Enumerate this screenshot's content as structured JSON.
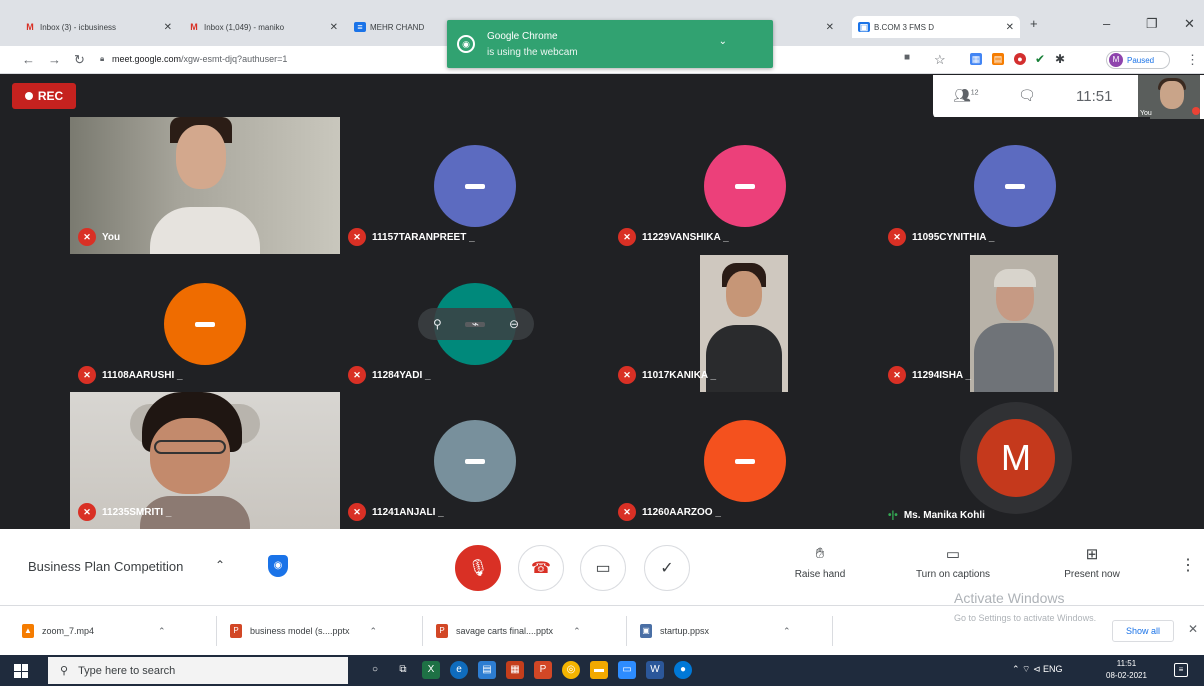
{
  "browser": {
    "tabs": [
      {
        "label": "Inbox (3) - icbusiness",
        "icon": "gmail-icon"
      },
      {
        "label": "Inbox (1,049) - maniko",
        "icon": "gmail-icon"
      },
      {
        "label": "MEHR CHAND",
        "icon": "docs-icon"
      },
      {
        "label": "B.COM 3 FMS D",
        "icon": "meet-icon"
      }
    ],
    "new_tab": "+",
    "url_domain": "meet.google.com",
    "url_path": "/xgw-esmt-djq?authuser=1",
    "profile_status": "Paused",
    "profile_initial": "M",
    "window_controls": [
      "–",
      "❐",
      "✕"
    ]
  },
  "webcam_notice": {
    "title": "Google Chrome",
    "message": "is using the webcam"
  },
  "meet": {
    "rec_label": "REC",
    "participants_count": "12",
    "time": "11:51",
    "self_label": "You",
    "tiles": [
      {
        "name": "You",
        "type": "video",
        "muted": true
      },
      {
        "name": "11157TARANPREET _",
        "type": "avatar",
        "color": "#5c6bc0",
        "muted": true
      },
      {
        "name": "11229VANSHIKA _",
        "type": "avatar",
        "color": "#ec407a",
        "muted": true
      },
      {
        "name": "11095CYNITHIA _",
        "type": "avatar",
        "color": "#5c6bc0",
        "muted": true
      },
      {
        "name": "11108AARUSHI _",
        "type": "avatar",
        "color": "#ef6c00",
        "muted": true
      },
      {
        "name": "11284YADI _",
        "type": "avatar",
        "color": "#00897b",
        "muted": true
      },
      {
        "name": "11017KANIKA _",
        "type": "video",
        "muted": true
      },
      {
        "name": "11294ISHA _",
        "type": "video",
        "muted": true
      },
      {
        "name": "11235SMRITI _",
        "type": "video",
        "muted": true
      },
      {
        "name": "11241ANJALI _",
        "type": "avatar",
        "color": "#78909c",
        "muted": true
      },
      {
        "name": "11260AARZOO _",
        "type": "avatar",
        "color": "#f4511e",
        "muted": true
      },
      {
        "name": "Ms. Manika Kohli",
        "type": "speaking",
        "initial": "M",
        "muted": false
      }
    ],
    "meeting_title": "Business Plan Competition",
    "actions": {
      "raise_hand": "Raise hand",
      "captions": "Turn on captions",
      "present": "Present now"
    }
  },
  "watermark": {
    "line1": "Activate Windows",
    "line2": "Go to Settings to activate Windows."
  },
  "downloads": {
    "items": [
      {
        "name": "zoom_7.mp4",
        "icon": "vlc-icon"
      },
      {
        "name": "business model (s....pptx",
        "icon": "powerpoint-icon"
      },
      {
        "name": "savage carts final....pptx",
        "icon": "powerpoint-icon"
      },
      {
        "name": "startup.ppsx",
        "icon": "powerpoint-show-icon"
      }
    ],
    "show_all": "Show all"
  },
  "taskbar": {
    "search_placeholder": "Type here to search",
    "time": "11:51",
    "date": "08-02-2021",
    "lang": "ENG"
  },
  "colors": {
    "meet_bg": "#202124",
    "tile_bg": "#3c4043",
    "hangup_red": "#d93025",
    "notice_green": "#31a271"
  }
}
